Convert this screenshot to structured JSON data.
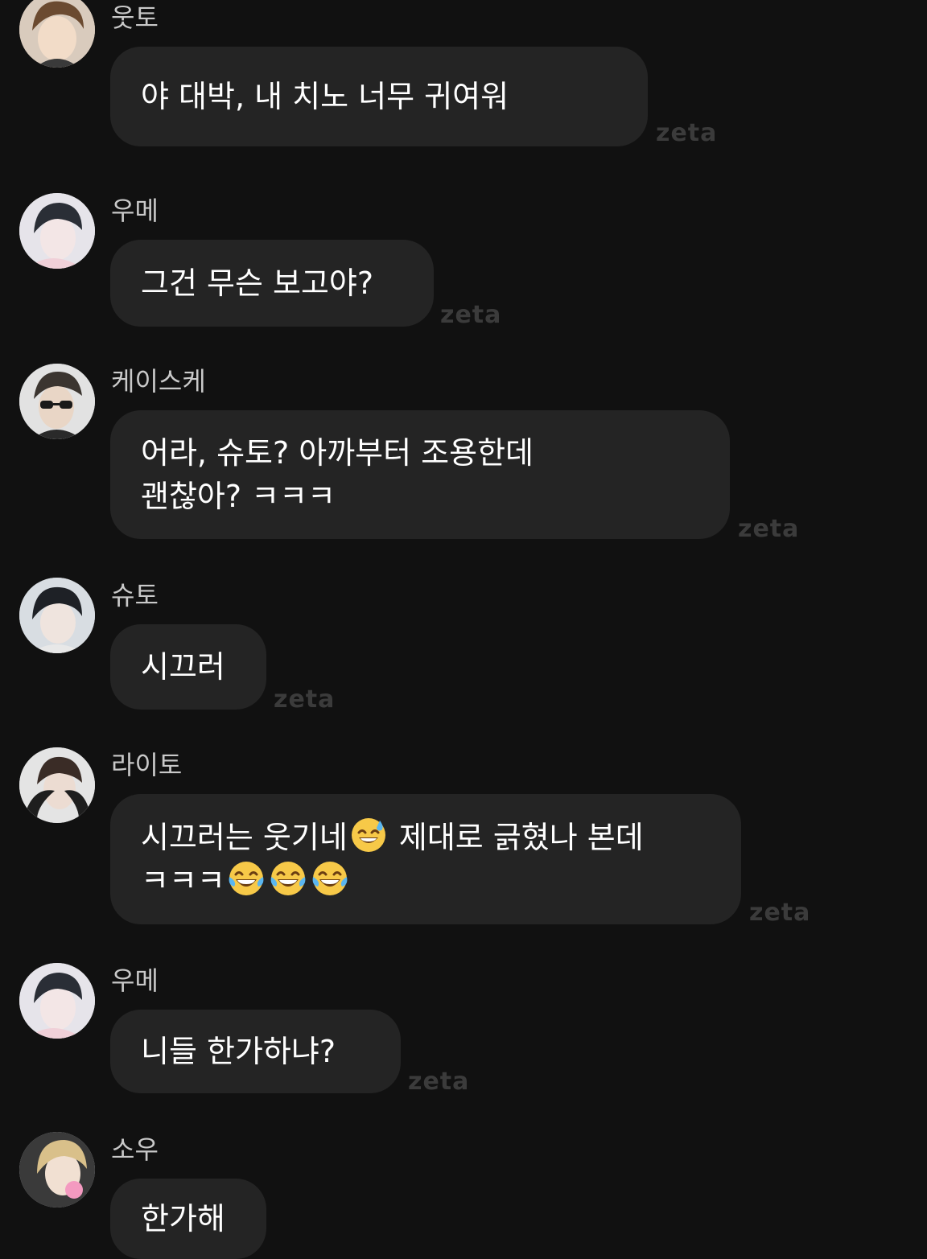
{
  "watermark": "zeta",
  "colors": {
    "background": "#111111",
    "bubble": "#242424",
    "sender_name": "#c9c9c9",
    "message_text": "#ffffff",
    "watermark": "#3b3b3b"
  },
  "messages": [
    {
      "sender": "웃토",
      "text": "야 대박, 내 치노 너무 귀여워",
      "avatar_icon": "avatar-brown-hair-icon"
    },
    {
      "sender": "우메",
      "text": "그건 무슨 보고야?",
      "avatar_icon": "avatar-dark-hair-icon"
    },
    {
      "sender": "케이스케",
      "text_line1": "어라, 슈토? 아까부터 조용한데",
      "text_line2": "괜찮아? ㅋㅋㅋ",
      "avatar_icon": "avatar-sunglasses-icon"
    },
    {
      "sender": "슈토",
      "text": "시끄러",
      "avatar_icon": "avatar-black-hair-icon"
    },
    {
      "sender": "라이토",
      "text_line1_a": "시끄러는 웃기네",
      "text_line1_b": " 제대로 긁혔나 본데",
      "text_line2": "ㅋㅋㅋ",
      "emoji_line1": "sweat-smile-emoji",
      "emoji_line2": [
        "joy-emoji",
        "joy-emoji",
        "joy-emoji"
      ],
      "avatar_icon": "avatar-hooded-icon"
    },
    {
      "sender": "우메",
      "text": "니들 한가하냐?",
      "avatar_icon": "avatar-dark-hair-icon"
    },
    {
      "sender": "소우",
      "text": "한가해",
      "avatar_icon": "avatar-blonde-bubblegum-icon"
    }
  ]
}
